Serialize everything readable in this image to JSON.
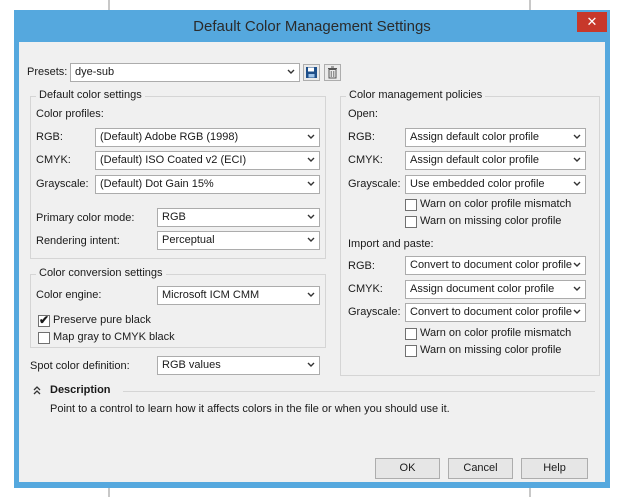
{
  "window": {
    "title": "Default Color Management Settings",
    "close_glyph": "✕"
  },
  "presets": {
    "label": "Presets:",
    "value": "dye-sub",
    "save_icon": "floppy-disk-icon",
    "delete_icon": "trash-icon"
  },
  "default_color": {
    "group_title": "Default color settings",
    "profiles_label": "Color profiles:",
    "rgb_label": "RGB:",
    "rgb_value": "(Default) Adobe RGB (1998)",
    "cmyk_label": "CMYK:",
    "cmyk_value": "(Default) ISO Coated v2 (ECI)",
    "gray_label": "Grayscale:",
    "gray_value": "(Default) Dot Gain 15%",
    "primary_label": "Primary color mode:",
    "primary_value": "RGB",
    "intent_label": "Rendering intent:",
    "intent_value": "Perceptual"
  },
  "conversion": {
    "group_title": "Color conversion settings",
    "engine_label": "Color engine:",
    "engine_value": "Microsoft ICM CMM",
    "preserve_black": {
      "label": "Preserve pure black",
      "checked": true
    },
    "map_gray": {
      "label": "Map gray to CMYK black",
      "checked": false
    }
  },
  "spot": {
    "label": "Spot color definition:",
    "value": "RGB values"
  },
  "policies": {
    "group_title": "Color management policies",
    "open_label": "Open:",
    "open_rgb_label": "RGB:",
    "open_rgb_value": "Assign default color profile",
    "open_cmyk_label": "CMYK:",
    "open_cmyk_value": "Assign default color profile",
    "open_gray_label": "Grayscale:",
    "open_gray_value": "Use embedded color profile",
    "open_warn_mismatch": "Warn on color profile mismatch",
    "open_warn_missing": "Warn on missing color profile",
    "import_label": "Import and paste:",
    "imp_rgb_label": "RGB:",
    "imp_rgb_value": "Convert to document color profile",
    "imp_cmyk_label": "CMYK:",
    "imp_cmyk_value": "Assign document color profile",
    "imp_gray_label": "Grayscale:",
    "imp_gray_value": "Convert to document color profile",
    "imp_warn_mismatch": "Warn on color profile mismatch",
    "imp_warn_missing": "Warn on missing color profile"
  },
  "description": {
    "title": "Description",
    "text": "Point to a control to learn how it affects colors in the file or when you should use it.",
    "collapse_icon": "double-chevron-up-icon"
  },
  "buttons": {
    "ok": "OK",
    "cancel": "Cancel",
    "help": "Help"
  },
  "colors": {
    "title_bar": "#55a8de",
    "close": "#c7382b",
    "client": "#f0f0f0"
  }
}
